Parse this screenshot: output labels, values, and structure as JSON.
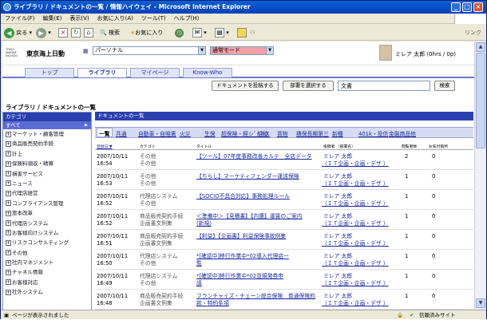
{
  "window": {
    "title": "ライブラリ / ドキュメントの一覧 / 情報ハイウェイ - Microsoft Internet Explorer"
  },
  "menu": [
    "ファイル(F)",
    "編集(E)",
    "表示(V)",
    "お気に入り(A)",
    "ツール(T)",
    "ヘルプ(H)"
  ],
  "toolbar": {
    "back": "戻る",
    "search": "検索",
    "favorites": "お気に入り",
    "link": "リンク"
  },
  "header": {
    "logo_small": "TOKIO MARINE NICHIDO",
    "logo": "東京海上日動",
    "portal_select": "パーソナル",
    "mode_select": "通常モード",
    "user": "ミレア 太郎 (0hrs / 0p)"
  },
  "tabs": [
    "トップ",
    "ライブラリ",
    "マイページ",
    "Know-Who"
  ],
  "actions": {
    "post": "ドキュメントを投稿する",
    "select_dept": "部署を選択する",
    "search_value": "文書",
    "search_btn": "検索"
  },
  "breadcrumb": "ライブラリ / ドキュメントの一覧",
  "sidebar": {
    "header": "カテゴリ",
    "all": "すべて",
    "items": [
      "マーケット・顧客管理",
      "商品販売契約手続",
      "計上",
      "保険料領収・精算",
      "損害サービス",
      "ニュース",
      "代理店経営",
      "コンプライアンス管理",
      "旅本改革",
      "代理店システム",
      "お客様向けシステム",
      "リスクコンサルティング",
      "その他",
      "社内マネジメント",
      "チャネル情報",
      "お客様対応",
      "社外システム"
    ]
  },
  "main": {
    "header": "ドキュメントの一覧",
    "cat_tabs": [
      "一覧",
      "共通",
      "自動車・自賠責",
      "火災",
      "生保",
      "超保険・経シ゛ネス",
      "船舶",
      "貨物",
      "積保長期第三",
      "新種",
      "401k・投信",
      "金融商品他"
    ],
    "columns": {
      "date": "登録日 ▼",
      "category": "カテゴリ",
      "title": "タイトル",
      "poster": "投稿者 （部署名）",
      "views": "閲覧者数",
      "comments": "お気付箇所"
    },
    "rows": [
      {
        "date": "2007/10/11",
        "time": "16:54",
        "cat1": "その他",
        "cat2": "その他",
        "title1": "【ツール】07年度事務改善カルテ　全店データ",
        "title2": "",
        "name": "ミレア 太郎",
        "dept": "（ＩＴ企画・企画・デザ ）",
        "views": "2",
        "comments": "0"
      },
      {
        "date": "2007/10/11",
        "time": "16:53",
        "cat1": "その他",
        "cat2": "その他",
        "title1": "【ちらし】マーケティフェンダー運送保険",
        "title2": "",
        "name": "ミレア 太郎",
        "dept": "（ＩＴ企画・企画・デザ ）",
        "views": "1",
        "comments": "0"
      },
      {
        "date": "2007/10/11",
        "time": "16:52",
        "cat1": "代理店システム",
        "cat2": "その他",
        "title1": "【SOCIO不具合対応】事務処理ルール",
        "title2": "",
        "name": "ミレア 太郎",
        "dept": "（ＩＴ企画・企画・デザ ）",
        "views": "1",
        "comments": "0"
      },
      {
        "date": "2007/10/11",
        "time": "16:52",
        "cat1": "商品販売契約手続",
        "cat2": "企画書文例集",
        "title1": "＜準備中＞【見積書】【内還】運賃のご案内",
        "title2": "(新規)",
        "name": "ミレア 太郎",
        "dept": "（ＩＴ企画・企画・デザ ）",
        "views": "1",
        "comments": "0"
      },
      {
        "date": "2007/10/11",
        "time": "16:51",
        "cat1": "商品販売契約手続",
        "cat2": "企画書文例集",
        "title1": "【利益】【企画書】利益保険事故例集",
        "title2": "",
        "name": "ミレア 太郎",
        "dept": "（ＩＴ企画・企画・デザ ）",
        "views": "1",
        "comments": "0"
      },
      {
        "date": "2007/10/11",
        "time": "16:50",
        "cat1": "代理店システム",
        "cat2": "その他",
        "title1": "*[確認中]移行作業中*02導入代理店一",
        "title2": "覧",
        "name": "ミレア 太郎",
        "dept": "（ＩＴ企画・企画・デザ ）",
        "views": "1",
        "comments": "0"
      },
      {
        "date": "2007/10/11",
        "time": "16:49",
        "cat1": "代理店システム",
        "cat2": "その他",
        "title1": "*[確認中]移行作業中*02並規発券申",
        "title2": "請",
        "name": "ミレア 太郎",
        "dept": "（ＩＴ企画・企画・デザ ）",
        "views": "1",
        "comments": "0"
      },
      {
        "date": "2007/10/11",
        "time": "16:48",
        "cat1": "商品販売契約手続",
        "cat2": "企画書文例集",
        "title1": "フランチャイズ・チェーン総合保険　普通保険約",
        "title2": "款・特約条項",
        "name": "ミレア 太郎",
        "dept": "（ＩＴ企画・企画・デザ ）",
        "views": "1",
        "comments": "0"
      }
    ]
  },
  "status": {
    "left": "ページが表示されました",
    "right": "信頼済みサイト"
  }
}
